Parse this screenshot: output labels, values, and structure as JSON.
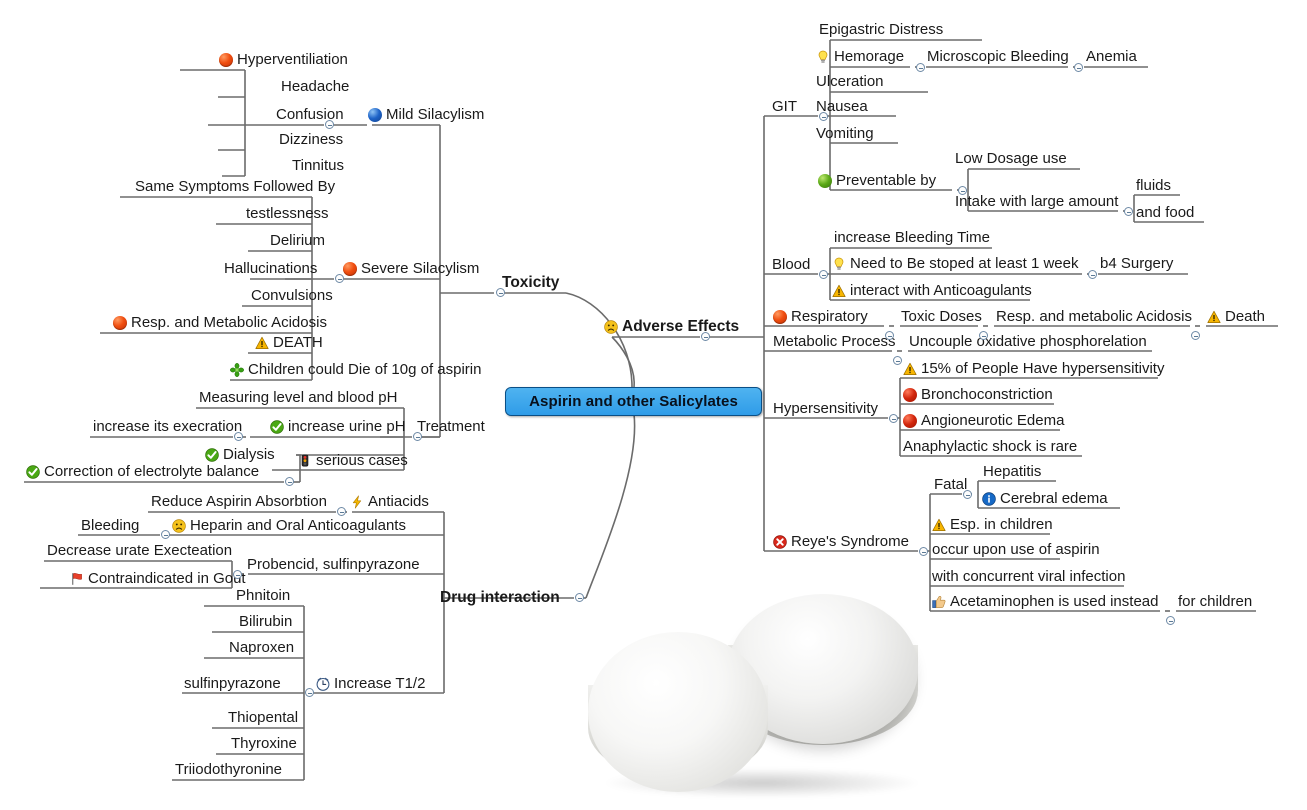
{
  "central": {
    "label": "Aspirin and other Salicylates",
    "color": "#2f9ce8"
  },
  "branches": {
    "toxicity": {
      "label": "Toxicity"
    },
    "drug_interaction": {
      "label": "Drug interaction"
    },
    "adverse_effects": {
      "label": "Adverse Effects",
      "icon": "sad-face-icon"
    }
  },
  "toxicity": {
    "mild": {
      "label": "Mild Silacylism",
      "icon": "blue-ball-icon",
      "items": [
        {
          "label": "Hyperventiliation",
          "icon": "red-ball-icon"
        },
        {
          "label": "Headache"
        },
        {
          "label": "Confusion"
        },
        {
          "label": "Dizziness"
        },
        {
          "label": "Tinnitus"
        }
      ]
    },
    "severe": {
      "label": "Severe Silacylism",
      "icon": "red-ball-icon",
      "items": [
        {
          "label": "Same Symptoms Followed By"
        },
        {
          "label": "testlessness"
        },
        {
          "label": "Delirium"
        },
        {
          "label": "Hallucinations"
        },
        {
          "label": "Convulsions"
        },
        {
          "label": "Resp. and Metabolic Acidosis",
          "icon": "red-ball-icon"
        },
        {
          "label": "DEATH",
          "icon": "warning-icon"
        },
        {
          "label": "Children could Die of 10g of aspirin",
          "icon": "green-flower-icon"
        }
      ]
    },
    "treatment": {
      "label": "Treatment",
      "items": [
        {
          "label": "Measuring level and blood pH"
        },
        {
          "label": "increase urine pH",
          "icon": "green-check-icon",
          "child": "increase its execration"
        },
        {
          "label": "Dialysis",
          "icon": "green-check-icon"
        },
        {
          "label": "serious cases",
          "icon": "traffic-light-icon",
          "child": "Correction of electrolyte balance",
          "child_icon": "green-check-icon"
        }
      ]
    }
  },
  "drug_interaction": {
    "items": [
      {
        "label": "Antiacids",
        "icon": "lightning-icon",
        "child": "Reduce Aspirin Absorbtion"
      },
      {
        "label": "Heparin and Oral Anticoagulants",
        "icon": "sad-face-icon",
        "child": "Bleeding"
      },
      {
        "label": "Probencid, sulfinpyrazone",
        "children": [
          {
            "label": "Decrease urate Execteation"
          },
          {
            "label": "Contraindicated in Gout",
            "icon": "red-flag-icon"
          }
        ]
      },
      {
        "label": "Increase T1/2",
        "icon": "clock-icon",
        "children": [
          {
            "label": "Phnitoin"
          },
          {
            "label": "Bilirubin"
          },
          {
            "label": "Naproxen"
          },
          {
            "label": "sulfinpyrazone"
          },
          {
            "label": "Thiopental"
          },
          {
            "label": "Thyroxine"
          },
          {
            "label": "Triiodothyronine"
          }
        ]
      }
    ]
  },
  "adverse_effects": {
    "git": {
      "label": "GIT",
      "items": [
        {
          "label": "Epigastric Distress"
        },
        {
          "label": "Hemorage",
          "icon": "lightbulb-icon",
          "child": "Microscopic Bleeding",
          "grandchild": "Anemia"
        },
        {
          "label": "Ulceration"
        },
        {
          "label": "Nausea"
        },
        {
          "label": "Vomiting"
        },
        {
          "label": "Preventable by",
          "icon": "green-ball-icon",
          "children": [
            {
              "label": "Low Dosage use"
            },
            {
              "label": "Intake with large amount",
              "children": [
                {
                  "label": "fluids"
                },
                {
                  "label": "and food"
                }
              ]
            }
          ]
        }
      ]
    },
    "blood": {
      "label": "Blood",
      "items": [
        {
          "label": "increase Bleeding Time"
        },
        {
          "label": "Need to Be stoped at least 1 week",
          "icon": "lightbulb-icon",
          "child": "b4 Surgery"
        },
        {
          "label": "interact with Anticoagulants",
          "icon": "warning-icon"
        }
      ]
    },
    "respiratory": {
      "label": "Respiratory",
      "icon": "red-ball-icon",
      "chain": [
        {
          "label": "Toxic Doses"
        },
        {
          "label": "Resp. and metabolic Acidosis"
        },
        {
          "label": "Death",
          "icon": "warning-icon"
        }
      ]
    },
    "metabolic": {
      "label": "Metabolic Process",
      "child": "Uncouple oxidative phosphorelation"
    },
    "hypersensitivity": {
      "label": "Hypersensitivity",
      "items": [
        {
          "label": "15% of People Have hypersensitivity",
          "icon": "warning-icon"
        },
        {
          "label": "Bronchoconstriction",
          "icon": "red-ball-icon"
        },
        {
          "label": "Angioneurotic Edema",
          "icon": "red-ball-icon"
        },
        {
          "label": "Anaphylactic shock is rare"
        }
      ]
    },
    "reyes": {
      "label": "Reye's Syndrome",
      "icon": "error-x-icon",
      "items": [
        {
          "label": "Fatal",
          "children": [
            {
              "label": "Hepatitis"
            },
            {
              "label": "Cerebral edema",
              "icon": "info-icon"
            }
          ]
        },
        {
          "label": "Esp. in children",
          "icon": "warning-icon"
        },
        {
          "label": "occur upon use of aspirin"
        },
        {
          "label": "with concurrent viral infection"
        },
        {
          "label": "Acetaminophen is used instead",
          "icon": "thumbs-up-icon",
          "child": "for children"
        }
      ]
    }
  },
  "image": {
    "alt": "two white aspirin tablets"
  }
}
